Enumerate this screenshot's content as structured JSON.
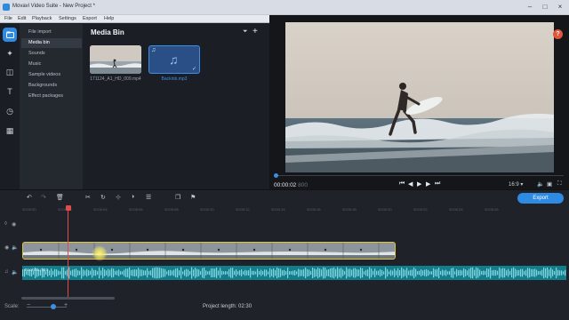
{
  "window": {
    "title": "Movavi Video Suite - New Project *"
  },
  "menu": [
    "File",
    "Edit",
    "Playback",
    "Settings",
    "Export",
    "Help"
  ],
  "categories": [
    {
      "label": "File import"
    },
    {
      "label": "Media bin",
      "active": true
    },
    {
      "label": "Sounds"
    },
    {
      "label": "Music"
    },
    {
      "label": "Sample videos"
    },
    {
      "label": "Backgrounds"
    },
    {
      "label": "Effect packages"
    }
  ],
  "media_bin": {
    "title": "Media Bin",
    "items": [
      {
        "name": "171124_A1_HD_009.mp4",
        "type": "video"
      },
      {
        "name": "Backinb.mp3",
        "type": "audio",
        "selected": true
      }
    ]
  },
  "preview": {
    "help": "?",
    "time": "00:00:02",
    "time_ms": "800",
    "aspect": "16:9"
  },
  "timeline": {
    "export_label": "Export",
    "ruler": [
      "00:00:00",
      "00:00:02",
      "00:00:04",
      "00:00:06",
      "00:00:08",
      "00:00:10",
      "00:00:12",
      "00:00:14",
      "00:00:16",
      "00:00:18",
      "00:00:20",
      "00:00:22",
      "00:00:24",
      "00:00:26"
    ],
    "audio_clip_label": "Backinb.mp3"
  },
  "status": {
    "scale_label": "Scale:",
    "project_length": "Project length: 02:30"
  },
  "colors": {
    "accent": "#2f8ae3",
    "playhead": "#e24b4b",
    "audio_clip": "#147d8c",
    "clip_border": "#e0c440",
    "help": "#e2553b"
  }
}
